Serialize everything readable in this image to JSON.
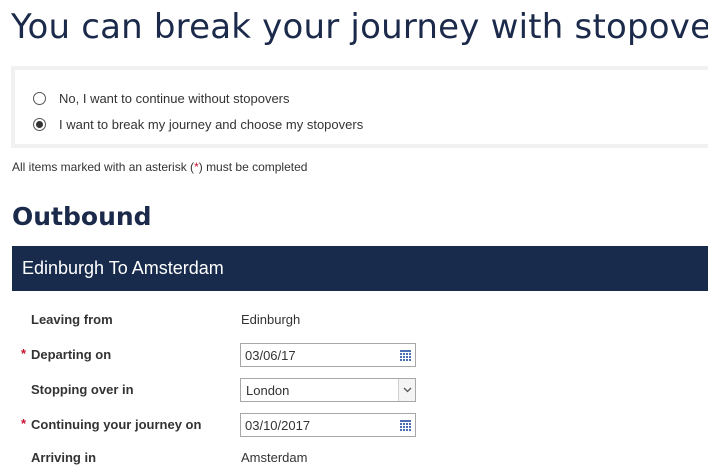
{
  "page": {
    "title": "You can break your journey with stopovers"
  },
  "stopover_options": [
    {
      "label": "No, I want to continue without stopovers",
      "selected": false
    },
    {
      "label": "I want to break my journey and choose my stopovers",
      "selected": true
    }
  ],
  "required_note": {
    "before": "All items marked with an asterisk (",
    "asterisk": "*",
    "after": ") must be completed"
  },
  "outbound": {
    "section_title": "Outbound",
    "route_title": "Edinburgh To Amsterdam",
    "fields": {
      "leaving_from": {
        "label": "Leaving from",
        "value": "Edinburgh"
      },
      "departing_on": {
        "label": "Departing on",
        "required": "*",
        "value": "03/06/17",
        "icon": "calendar-icon"
      },
      "stopping_over": {
        "label": "Stopping over in",
        "value": "London",
        "icon": "chevron-down-icon"
      },
      "continuing_on": {
        "label": "Continuing your journey on",
        "required": "*",
        "value": "03/10/2017",
        "icon": "calendar-icon"
      },
      "arriving_in": {
        "label": "Arriving in",
        "value": "Amsterdam"
      }
    }
  },
  "colors": {
    "heading": "#1b2a4a",
    "route_bar": "#182b4d",
    "required": "#c8102e",
    "options_border": "#f1f1f1"
  }
}
